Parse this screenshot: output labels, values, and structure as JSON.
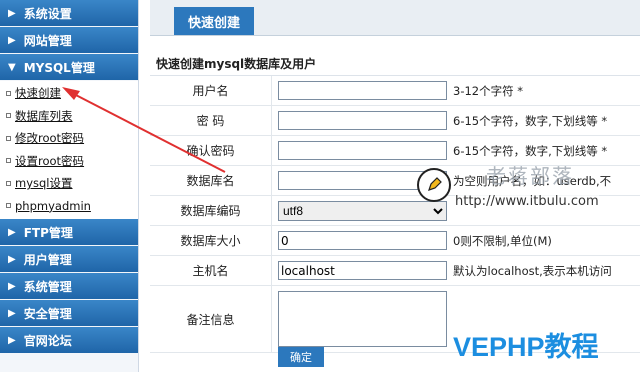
{
  "sidebar": {
    "sections_top": [
      {
        "label": "系统设置"
      },
      {
        "label": "网站管理"
      },
      {
        "label": "MYSQL管理"
      }
    ],
    "mysql_items": [
      {
        "label": "快速创建"
      },
      {
        "label": "数据库列表"
      },
      {
        "label": "修改root密码"
      },
      {
        "label": "设置root密码"
      },
      {
        "label": "mysql设置"
      },
      {
        "label": "phpmyadmin"
      }
    ],
    "sections_bottom": [
      {
        "label": "FTP管理"
      },
      {
        "label": "用户管理"
      },
      {
        "label": "系统管理"
      },
      {
        "label": "安全管理"
      },
      {
        "label": "官网论坛"
      }
    ]
  },
  "tab": {
    "label": "快速创建"
  },
  "form": {
    "title": "快速创建mysql数据库及用户",
    "fields": [
      {
        "label": "用户名",
        "value": "",
        "hint": "3-12个字符 *"
      },
      {
        "label": "密 码",
        "value": "",
        "hint": "6-15个字符，数字,下划线等 *"
      },
      {
        "label": "确认密码",
        "value": "",
        "hint": "6-15个字符，数字,下划线等 *"
      },
      {
        "label": "数据库名",
        "value": "",
        "hint": "为空则用户名，如：userdb,不"
      },
      {
        "label": "数据库编码",
        "value": "utf8",
        "hint": ""
      },
      {
        "label": "数据库大小",
        "value": "0",
        "hint": "0则不限制,单位(M)"
      },
      {
        "label": "主机名",
        "value": "localhost",
        "hint": "默认为localhost,表示本机访问"
      },
      {
        "label": "备注信息",
        "value": "",
        "hint": ""
      }
    ],
    "submit_label": "确定"
  },
  "watermarks": {
    "blog_name": "老蒋部落",
    "blog_url": "http://www.itbulu.com",
    "site": "VEPHP教程"
  },
  "colors": {
    "sidebar_header": "#2c78bd",
    "accent": "#2c78bd",
    "arrow": "#e03030"
  },
  "icons": [
    "triangle-right-icon",
    "pencil-icon"
  ]
}
